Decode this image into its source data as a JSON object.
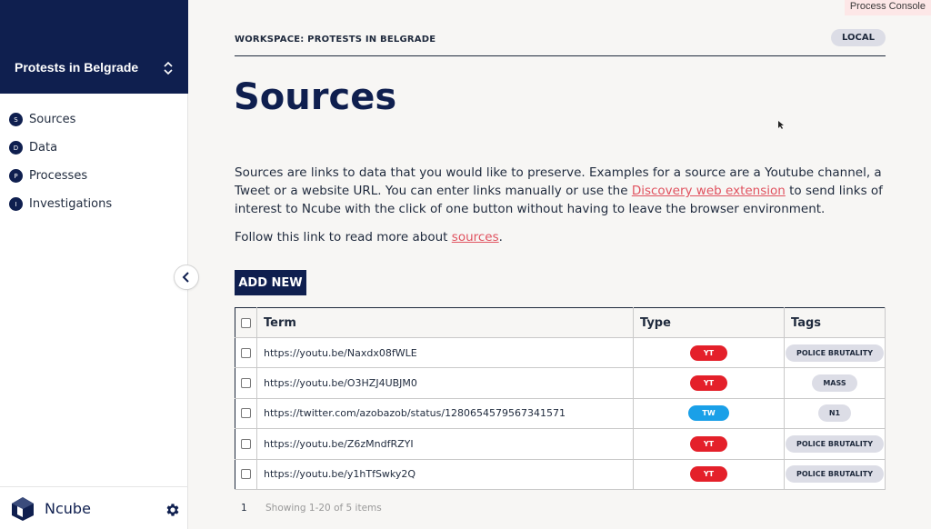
{
  "sidebar": {
    "workspace_name": "Protests in Belgrade",
    "items": [
      {
        "badge": "S",
        "label": "Sources"
      },
      {
        "badge": "D",
        "label": "Data"
      },
      {
        "badge": "P",
        "label": "Processes"
      },
      {
        "badge": "I",
        "label": "Investigations"
      }
    ],
    "brand": "Ncube"
  },
  "console_tab": "Process Console",
  "header": {
    "workspace_title": "WORKSPACE: PROTESTS IN BELGRADE",
    "local_badge": "LOCAL"
  },
  "page_title": "Sources",
  "description": {
    "part1": "Sources are links to data that you would like to preserve. Examples for a source are a Youtube channel, a Tweet or a website URL. You can enter links manually or use the ",
    "link": "Discovery web extension",
    "part2": " to send links of interest to Ncube with the click of one button without having to leave the browser environment."
  },
  "follow": {
    "text": "Follow this link to read more about ",
    "link": "sources",
    "end": "."
  },
  "add_button": "ADD NEW",
  "table": {
    "headers": {
      "term": "Term",
      "type": "Type",
      "tags": "Tags"
    },
    "rows": [
      {
        "term": "https://youtu.be/Naxdx08fWLE",
        "type": "YT",
        "tag": "POLICE BRUTALITY"
      },
      {
        "term": "https://youtu.be/O3HZJ4UBJM0",
        "type": "YT",
        "tag": "MASS"
      },
      {
        "term": "https://twitter.com/azobazob/status/1280654579567341571",
        "type": "TW",
        "tag": "N1"
      },
      {
        "term": "https://youtu.be/Z6zMndfRZYI",
        "type": "YT",
        "tag": "POLICE BRUTALITY"
      },
      {
        "term": "https://youtu.be/y1hTfSwky2Q",
        "type": "YT",
        "tag": "POLICE BRUTALITY"
      }
    ]
  },
  "pagination": {
    "page": "1",
    "showing": "Showing 1-20 of 5 items"
  },
  "colors": {
    "navy": "#0f1f4f",
    "yt": "#e4202a",
    "tw": "#1aa0e8",
    "link": "#e0525f",
    "tag_bg": "#dcdde6"
  },
  "icons": {
    "workspace_chevron": "chevron-up-down-icon",
    "collapse": "chevron-left-icon",
    "settings": "gear-icon",
    "logo": "ncube-logo-icon"
  }
}
